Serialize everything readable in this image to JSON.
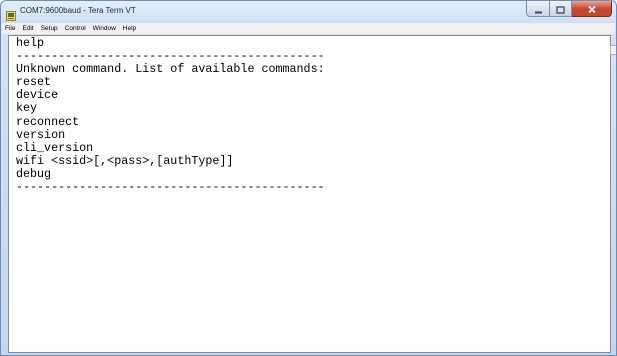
{
  "window": {
    "title": "COM7:9600baud - Tera Term VT"
  },
  "menu": {
    "items": [
      {
        "label": "File"
      },
      {
        "label": "Edit"
      },
      {
        "label": "Setup"
      },
      {
        "label": "Control"
      },
      {
        "label": "Window"
      },
      {
        "label": "Help"
      }
    ]
  },
  "terminal": {
    "lines": [
      "help",
      "--------------------------------------------",
      "Unknown command. List of available commands:",
      "reset",
      "device",
      "key",
      "reconnect",
      "version",
      "cli_version",
      "wifi <ssid>[,<pass>,[authType]]",
      "debug",
      "--------------------------------------------"
    ]
  },
  "colors": {
    "close_button": "#c7452d",
    "terminal_background": "#ffffff",
    "terminal_text": "#000000"
  },
  "icons": {
    "app": "tera-term-icon",
    "minimize": "minimize-icon",
    "maximize": "maximize-icon",
    "close": "close-icon"
  }
}
